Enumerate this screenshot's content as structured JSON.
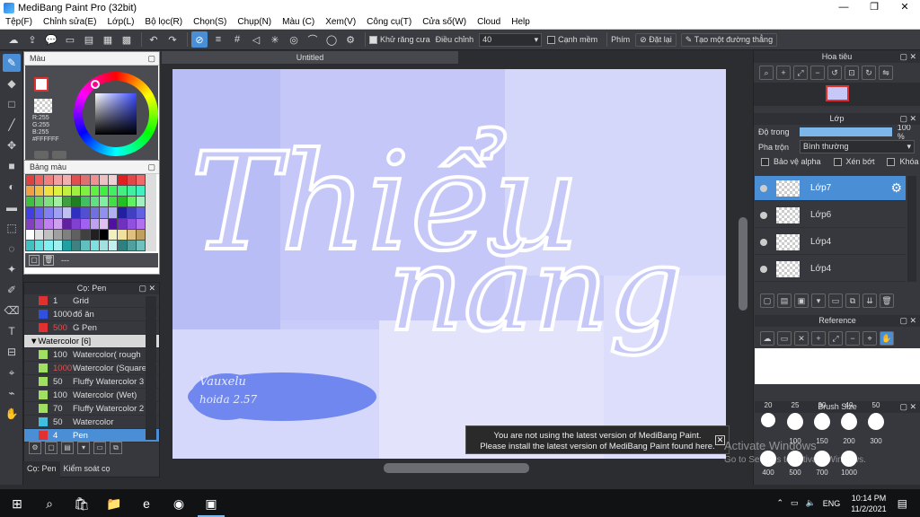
{
  "window": {
    "title": "MediBang Paint Pro (32bit)"
  },
  "menu": [
    "Tệp(F)",
    "Chỉnh sửa(E)",
    "Lớp(L)",
    "Bộ lọc(R)",
    "Chọn(S)",
    "Chụp(N)",
    "Màu (C)",
    "Xem(V)",
    "Công cụ(T)",
    "Cửa số(W)",
    "Cloud",
    "Help"
  ],
  "toolbar": {
    "antialias_label": "Khử răng cưa",
    "adjust_label": "Điều chỉnh",
    "adjust_value": "40",
    "edge_label": "Cạnh mềm",
    "key_label": "Phím",
    "reset_label": "Đặt lại",
    "create_line_label": "Tạo một đường thẳng"
  },
  "color_panel": {
    "title": "Màu",
    "r": "R:255",
    "g": "G:255",
    "b": "B:255",
    "hex": "#FFFFFF",
    "primary": "#ffffff",
    "secondary": "#f0d0a0"
  },
  "swatch_panel": {
    "title": "Bảng màu",
    "footer": "---",
    "colors": [
      "#e04040",
      "#f06060",
      "#f08080",
      "#f0a0a0",
      "#f0b0b0",
      "#e05050",
      "#e07070",
      "#f09090",
      "#f0c0c0",
      "#f0d0d0",
      "#e02020",
      "#e04848",
      "#f06868",
      "#f0a040",
      "#f0c040",
      "#f0e040",
      "#e0f040",
      "#c0f040",
      "#a0f040",
      "#80f040",
      "#60f040",
      "#40f040",
      "#40f060",
      "#40f080",
      "#40f0a0",
      "#40f0c0",
      "#40c040",
      "#60d060",
      "#80e080",
      "#a0f0a0",
      "#40a040",
      "#208020",
      "#40c060",
      "#60e080",
      "#80f0a0",
      "#40e040",
      "#20c020",
      "#60f060",
      "#a0f0c0",
      "#4040e0",
      "#6060f0",
      "#8080f0",
      "#a0a0f0",
      "#c0c0f0",
      "#3030c0",
      "#5050d0",
      "#7070e0",
      "#9090f0",
      "#b0b0f0",
      "#2020a0",
      "#4040c0",
      "#6060e0",
      "#8040c0",
      "#a060e0",
      "#c080f0",
      "#d0a0f0",
      "#6020a0",
      "#8040d0",
      "#a060f0",
      "#c0a0f0",
      "#e0c0f0",
      "#5010a0",
      "#7030c0",
      "#9050e0",
      "#b070f0",
      "#ffffff",
      "#e0e0e0",
      "#c0c0c0",
      "#a0a0a0",
      "#808080",
      "#606060",
      "#404040",
      "#202020",
      "#000000",
      "#f0f0c0",
      "#f0e0a0",
      "#e0c080",
      "#c0a060",
      "#40c0c0",
      "#60e0e0",
      "#80f0f0",
      "#a0f0f0",
      "#20a0a0",
      "#408080",
      "#60c0c0",
      "#80e0e0",
      "#a0e0e0",
      "#c0f0f0",
      "#308080",
      "#50a0a0",
      "#70c0c0"
    ]
  },
  "brush_panel": {
    "title": "Cọ: Pen",
    "rows": [
      {
        "size": "1",
        "name": "Grid",
        "color": "#e03030"
      },
      {
        "size": "1000",
        "name": "đổ ăn",
        "color": "#3050e0"
      },
      {
        "size": "500",
        "name": "G Pen",
        "color": "#e03030",
        "red": true
      },
      {
        "group": true,
        "name": "Watercolor [6]"
      },
      {
        "size": "100",
        "name": "Watercolor( rough",
        "color": "#a0e060"
      },
      {
        "size": "1000",
        "name": "Watercolor (Square",
        "color": "#a0e060",
        "red": true
      },
      {
        "size": "50",
        "name": "Fluffy Watercolor 3",
        "color": "#a0e060"
      },
      {
        "size": "100",
        "name": "Watercolor (Wet)",
        "color": "#a0e060"
      },
      {
        "size": "70",
        "name": "Fluffy Watercolor 2",
        "color": "#a0e060"
      },
      {
        "size": "50",
        "name": "Watercolor",
        "color": "#40c0e0"
      },
      {
        "size": "4",
        "name": "Pen",
        "color": "#e03030",
        "selected": true
      }
    ],
    "tab1": "Cọ: Pen",
    "tab2": "Kiểm soát cọ"
  },
  "document": {
    "tab": "Untitled"
  },
  "notice": {
    "line1": "You are not using the latest version of MediBang Paint.",
    "line2": "Please install the latest version of MediBang Paint found here."
  },
  "canvas_text": {
    "big1": "Thiểu",
    "big2": "năng",
    "sig1": "Vauxelu",
    "sig2": "hoida 2.57"
  },
  "navigator": {
    "title": "Hoa tiêu"
  },
  "layer_panel": {
    "title": "Lớp",
    "opacity_label": "Độ trong",
    "opacity_value": "100 %",
    "opacity": 1.0,
    "blend_label": "Pha trộn",
    "blend_value": "Bình thường",
    "protect_alpha": "Bảo vệ alpha",
    "clipping": "Xén bớt",
    "lock": "Khóa",
    "layers": [
      {
        "name": "Lớp7",
        "selected": true
      },
      {
        "name": "Lớp6"
      },
      {
        "name": "Lớp4"
      },
      {
        "name": "Lớp4"
      }
    ]
  },
  "reference": {
    "title": "Reference"
  },
  "brush_size": {
    "title": "Brush Size",
    "row1": [
      "20",
      "25",
      "30",
      "40",
      "50"
    ],
    "row2": [
      "100",
      "150",
      "200",
      "300"
    ],
    "row3": [
      "400",
      "500",
      "700",
      "1000"
    ]
  },
  "watermark": {
    "line1": "Activate Windows",
    "line2": "Go to Settings to activate Windows."
  },
  "taskbar": {
    "lang": "ENG",
    "time": "10:14 PM",
    "date": "11/2/2021"
  }
}
